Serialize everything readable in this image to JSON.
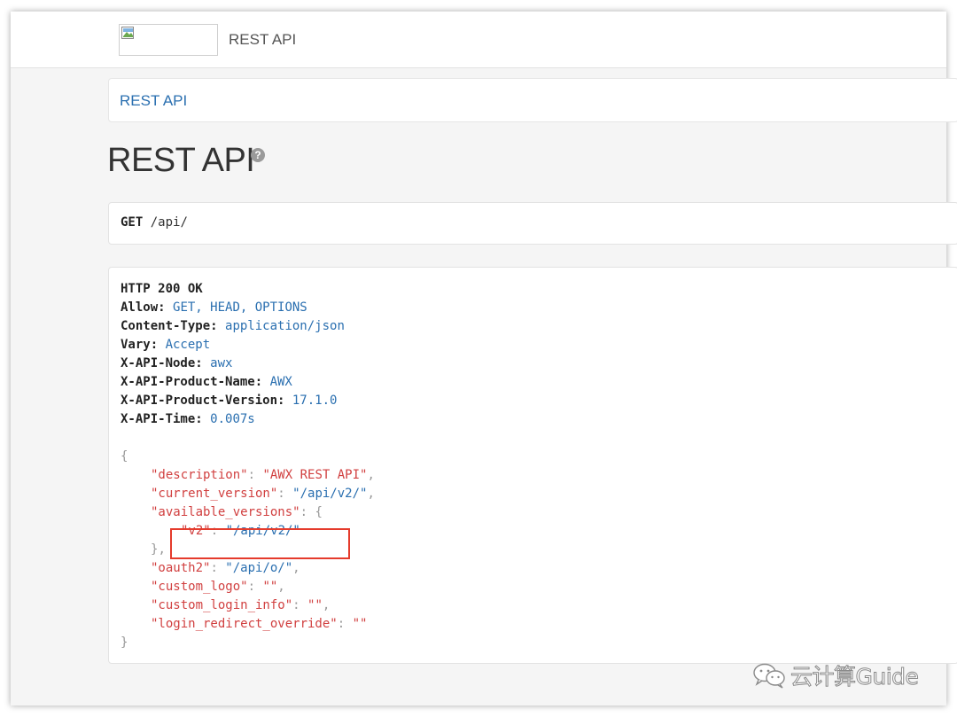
{
  "navbar": {
    "brand": "REST API",
    "logo_icon": "broken-image-icon"
  },
  "breadcrumb": {
    "link": "REST API"
  },
  "page": {
    "title": "REST API",
    "help_icon": "question-circle-icon",
    "help_glyph": "?"
  },
  "request": {
    "method": "GET",
    "path": "/api/"
  },
  "response": {
    "status": "HTTP 200 OK",
    "headers": [
      {
        "name": "Allow",
        "value": "GET, HEAD, OPTIONS"
      },
      {
        "name": "Content-Type",
        "value": "application/json"
      },
      {
        "name": "Vary",
        "value": "Accept"
      },
      {
        "name": "X-API-Node",
        "value": "awx"
      },
      {
        "name": "X-API-Product-Name",
        "value": "AWX"
      },
      {
        "name": "X-API-Product-Version",
        "value": "17.1.0"
      },
      {
        "name": "X-API-Time",
        "value": "0.007s"
      }
    ],
    "body": {
      "open": "{",
      "close": "}",
      "description": {
        "key": "\"description\"",
        "value": "\"AWX REST API\""
      },
      "current_version": {
        "key": "\"current_version\"",
        "value": "\"/api/v2/\""
      },
      "available_versions": {
        "key": "\"available_versions\"",
        "open": "{",
        "close": "}"
      },
      "v2": {
        "key": "\"v2\"",
        "value": "\"/api/v2/\""
      },
      "oauth2": {
        "key": "\"oauth2\"",
        "value": "\"/api/o/\""
      },
      "custom_logo": {
        "key": "\"custom_logo\"",
        "value": "\"\""
      },
      "custom_login_info": {
        "key": "\"custom_login_info\"",
        "value": "\"\""
      },
      "login_redirect_override": {
        "key": "\"login_redirect_override\"",
        "value": "\"\""
      }
    }
  },
  "watermark": {
    "text": "云计算Guide",
    "icon": "wechat-icon"
  },
  "colors": {
    "link": "#2a6fb0",
    "json_key": "#d14040",
    "highlight": "#e53b2c"
  }
}
